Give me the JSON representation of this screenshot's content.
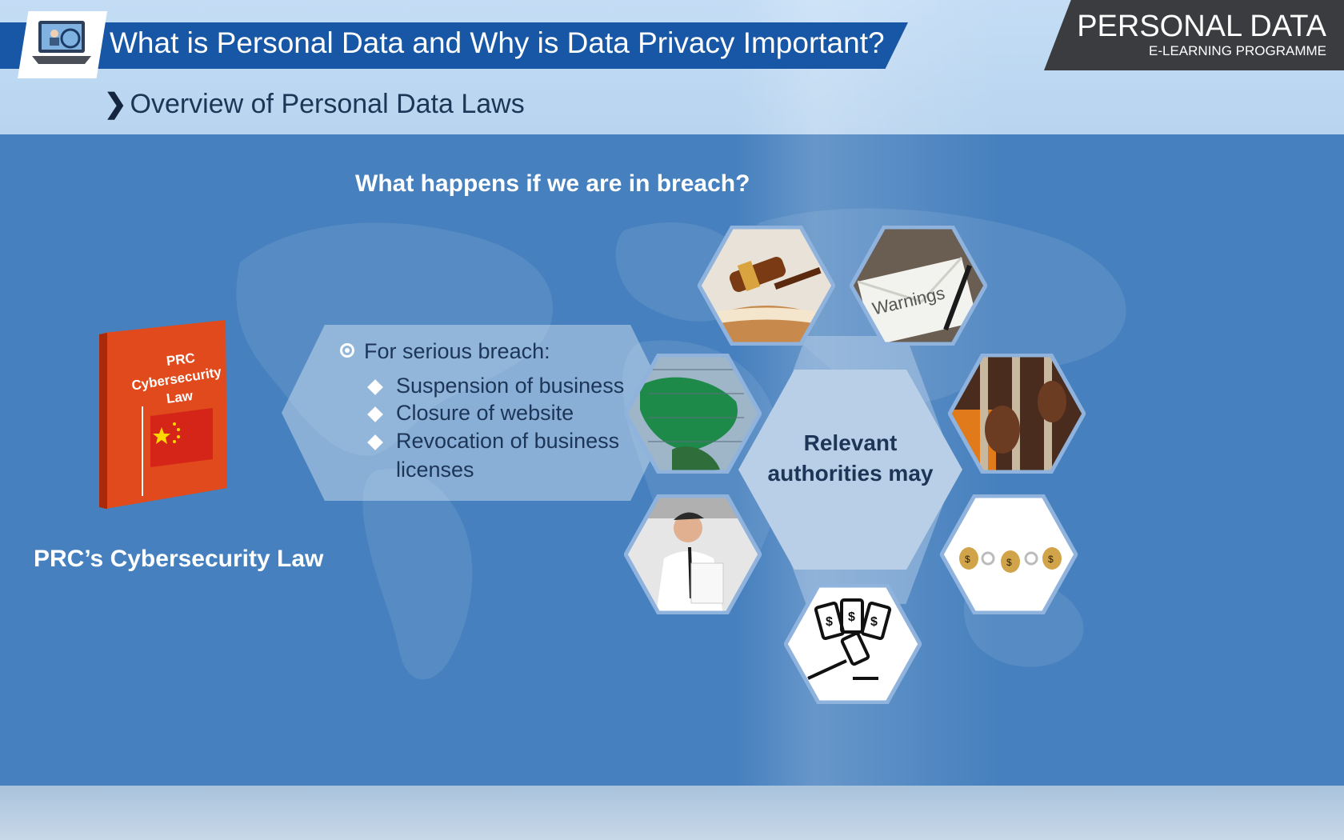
{
  "header": {
    "title": "What is Personal Data and Why is Data Privacy Important?",
    "subtitle": "Overview of Personal Data Laws",
    "chevron": "❯"
  },
  "brand": {
    "title": "PERSONAL DATA",
    "subtitle": "E-LEARNING PROGRAMME"
  },
  "content": {
    "question": "What happens if we are in breach?",
    "book": {
      "line1": "PRC",
      "line2": "Cybersecurity",
      "line3": "Law"
    },
    "law_caption": "PRC’s Cybersecurity Law",
    "breach": {
      "title": "For serious breach:",
      "items": [
        "Suspension of business",
        "Closure of website",
        "Revocation of business",
        "licenses"
      ]
    },
    "center": {
      "line1": "Relevant",
      "line2": "authorities may"
    },
    "icons": [
      "laptop-icon",
      "gavel-book-image",
      "warnings-envelope-image",
      "map-image",
      "prison-bars-image",
      "stressed-man-image",
      "money-bags-handcuffs-image",
      "fine-gavel-money-icon"
    ],
    "colors": {
      "banner": "#1757a5",
      "main_bg": "#4680be",
      "brand_bg": "#3a3c3f",
      "text_dark": "#1d3556"
    }
  }
}
